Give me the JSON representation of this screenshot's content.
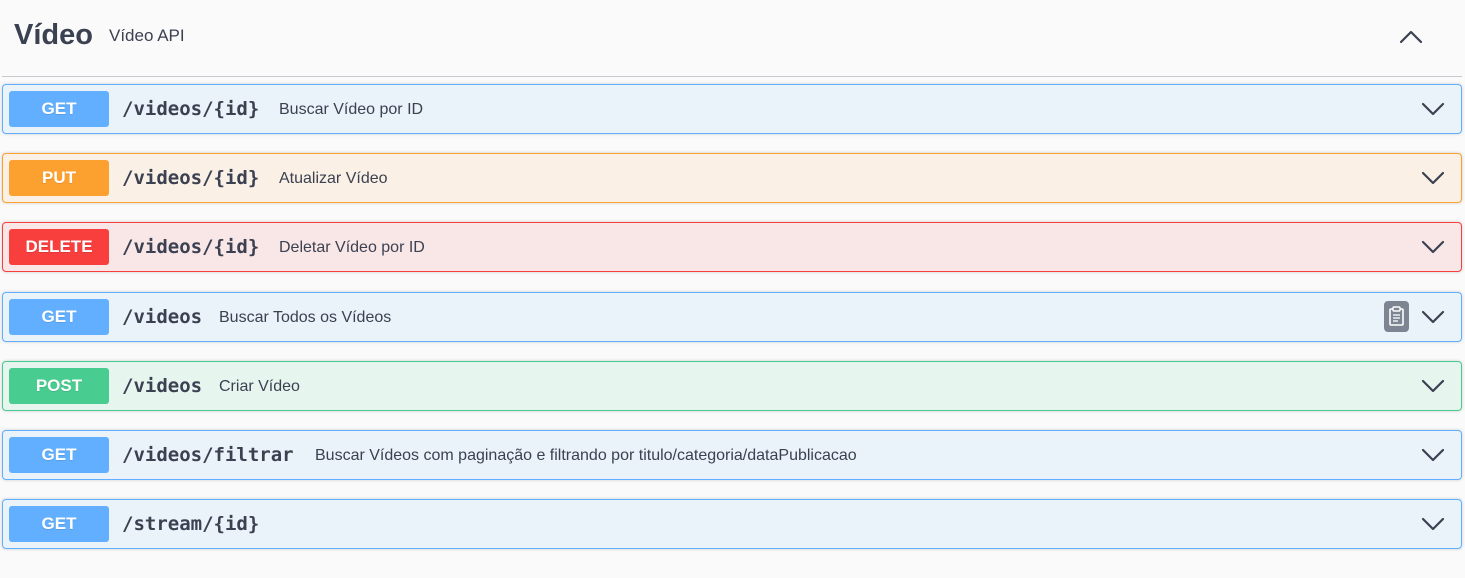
{
  "tag": {
    "title": "Vídeo",
    "description": "Vídeo API",
    "collapse_icon": "chevron-up-icon"
  },
  "operations": [
    {
      "method": "GET",
      "path": "/videos/{id}",
      "summary": "Buscar Vídeo por ID",
      "color": "#61affe"
    },
    {
      "method": "PUT",
      "path": "/videos/{id}",
      "summary": "Atualizar Vídeo",
      "color": "#fca130"
    },
    {
      "method": "DELETE",
      "path": "/videos/{id}",
      "summary": "Deletar Vídeo por ID",
      "color": "#f93e3e"
    },
    {
      "method": "GET",
      "path": "/videos",
      "summary": "Buscar Todos os Vídeos",
      "color": "#61affe",
      "copy_icon": "clipboard-icon"
    },
    {
      "method": "POST",
      "path": "/videos",
      "summary": "Criar Vídeo",
      "color": "#49cc90"
    },
    {
      "method": "GET",
      "path": "/videos/filtrar",
      "summary": "Buscar Vídeos com paginação e filtrando por titulo/categoria/dataPublicacao",
      "color": "#61affe"
    },
    {
      "method": "GET",
      "path": "/stream/{id}",
      "summary": "",
      "color": "#61affe"
    }
  ]
}
